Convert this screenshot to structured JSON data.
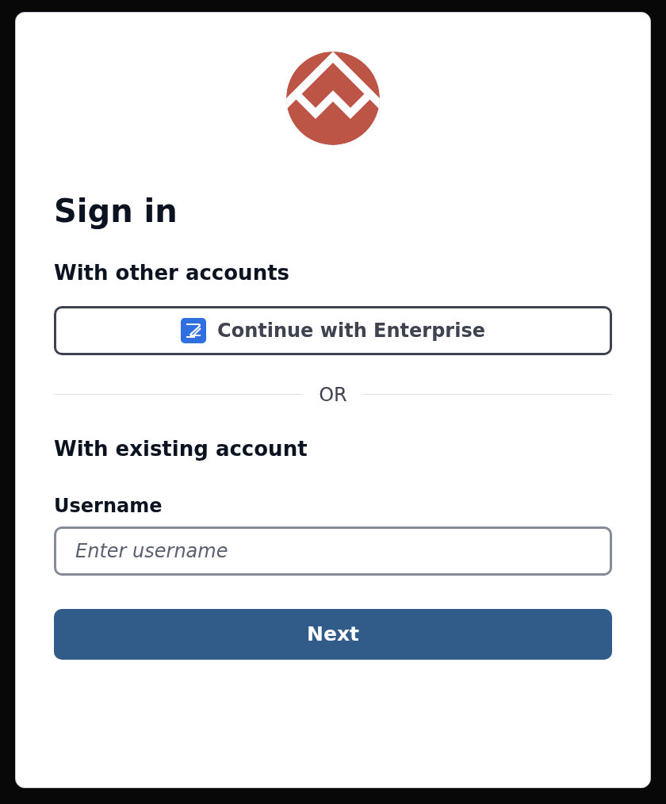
{
  "title": "Sign in",
  "other_accounts": {
    "heading": "With other accounts",
    "button": "Continue with Enterprise"
  },
  "divider": "OR",
  "existing_account": {
    "heading": "With existing account",
    "field_label": "Username",
    "placeholder": "Enter username"
  },
  "submit": "Next"
}
